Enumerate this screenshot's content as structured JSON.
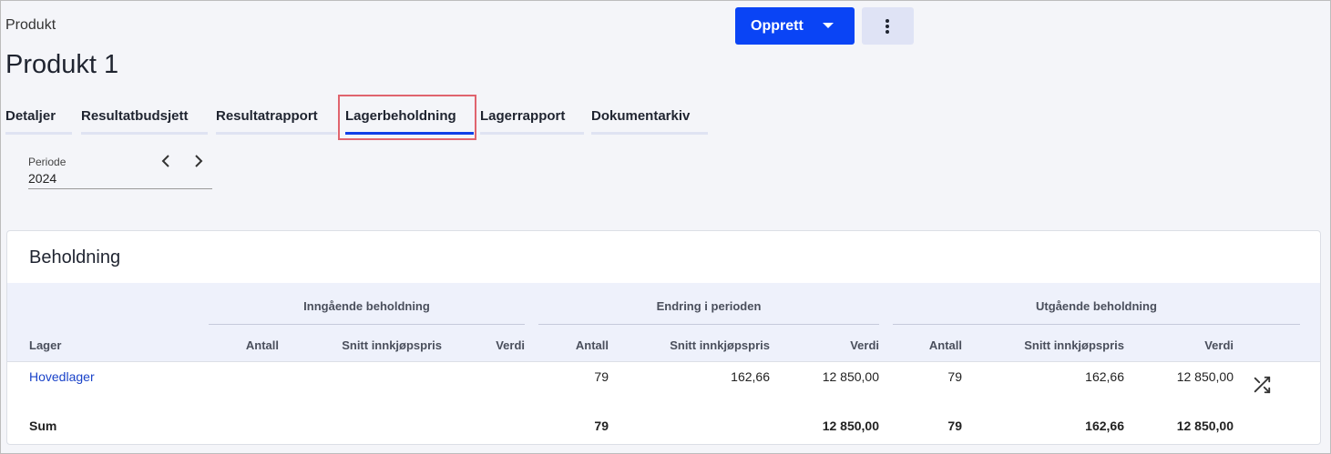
{
  "breadcrumb": "Produkt",
  "title": "Produkt 1",
  "actions": {
    "create_label": "Opprett"
  },
  "tabs": [
    "Detaljer",
    "Resultatbudsjett",
    "Resultatrapport",
    "Lagerbeholdning",
    "Lagerrapport",
    "Dokumentarkiv"
  ],
  "active_tab": "Lagerbeholdning",
  "period": {
    "label": "Periode",
    "value": "2024"
  },
  "card": {
    "title": "Beholdning",
    "groups": [
      "Inngående beholdning",
      "Endring i perioden",
      "Utgående beholdning"
    ],
    "columns": {
      "lager": "Lager",
      "antall": "Antall",
      "snitt": "Snitt innkjøpspris",
      "verdi": "Verdi"
    },
    "row": {
      "lager": "Hovedlager",
      "in_antall": "",
      "in_snitt": "",
      "in_verdi": "",
      "end_antall": "79",
      "end_snitt": "162,66",
      "end_verdi": "12 850,00",
      "ut_antall": "79",
      "ut_snitt": "162,66",
      "ut_verdi": "12 850,00"
    },
    "sum": {
      "label": "Sum",
      "end_antall": "79",
      "end_verdi": "12 850,00",
      "ut_antall": "79",
      "ut_snitt": "162,66",
      "ut_verdi": "12 850,00"
    }
  },
  "icons": {
    "more": "more-vertical-icon",
    "shuffle": "shuffle-icon",
    "prev": "chevron-left-icon",
    "next": "chevron-right-icon"
  }
}
